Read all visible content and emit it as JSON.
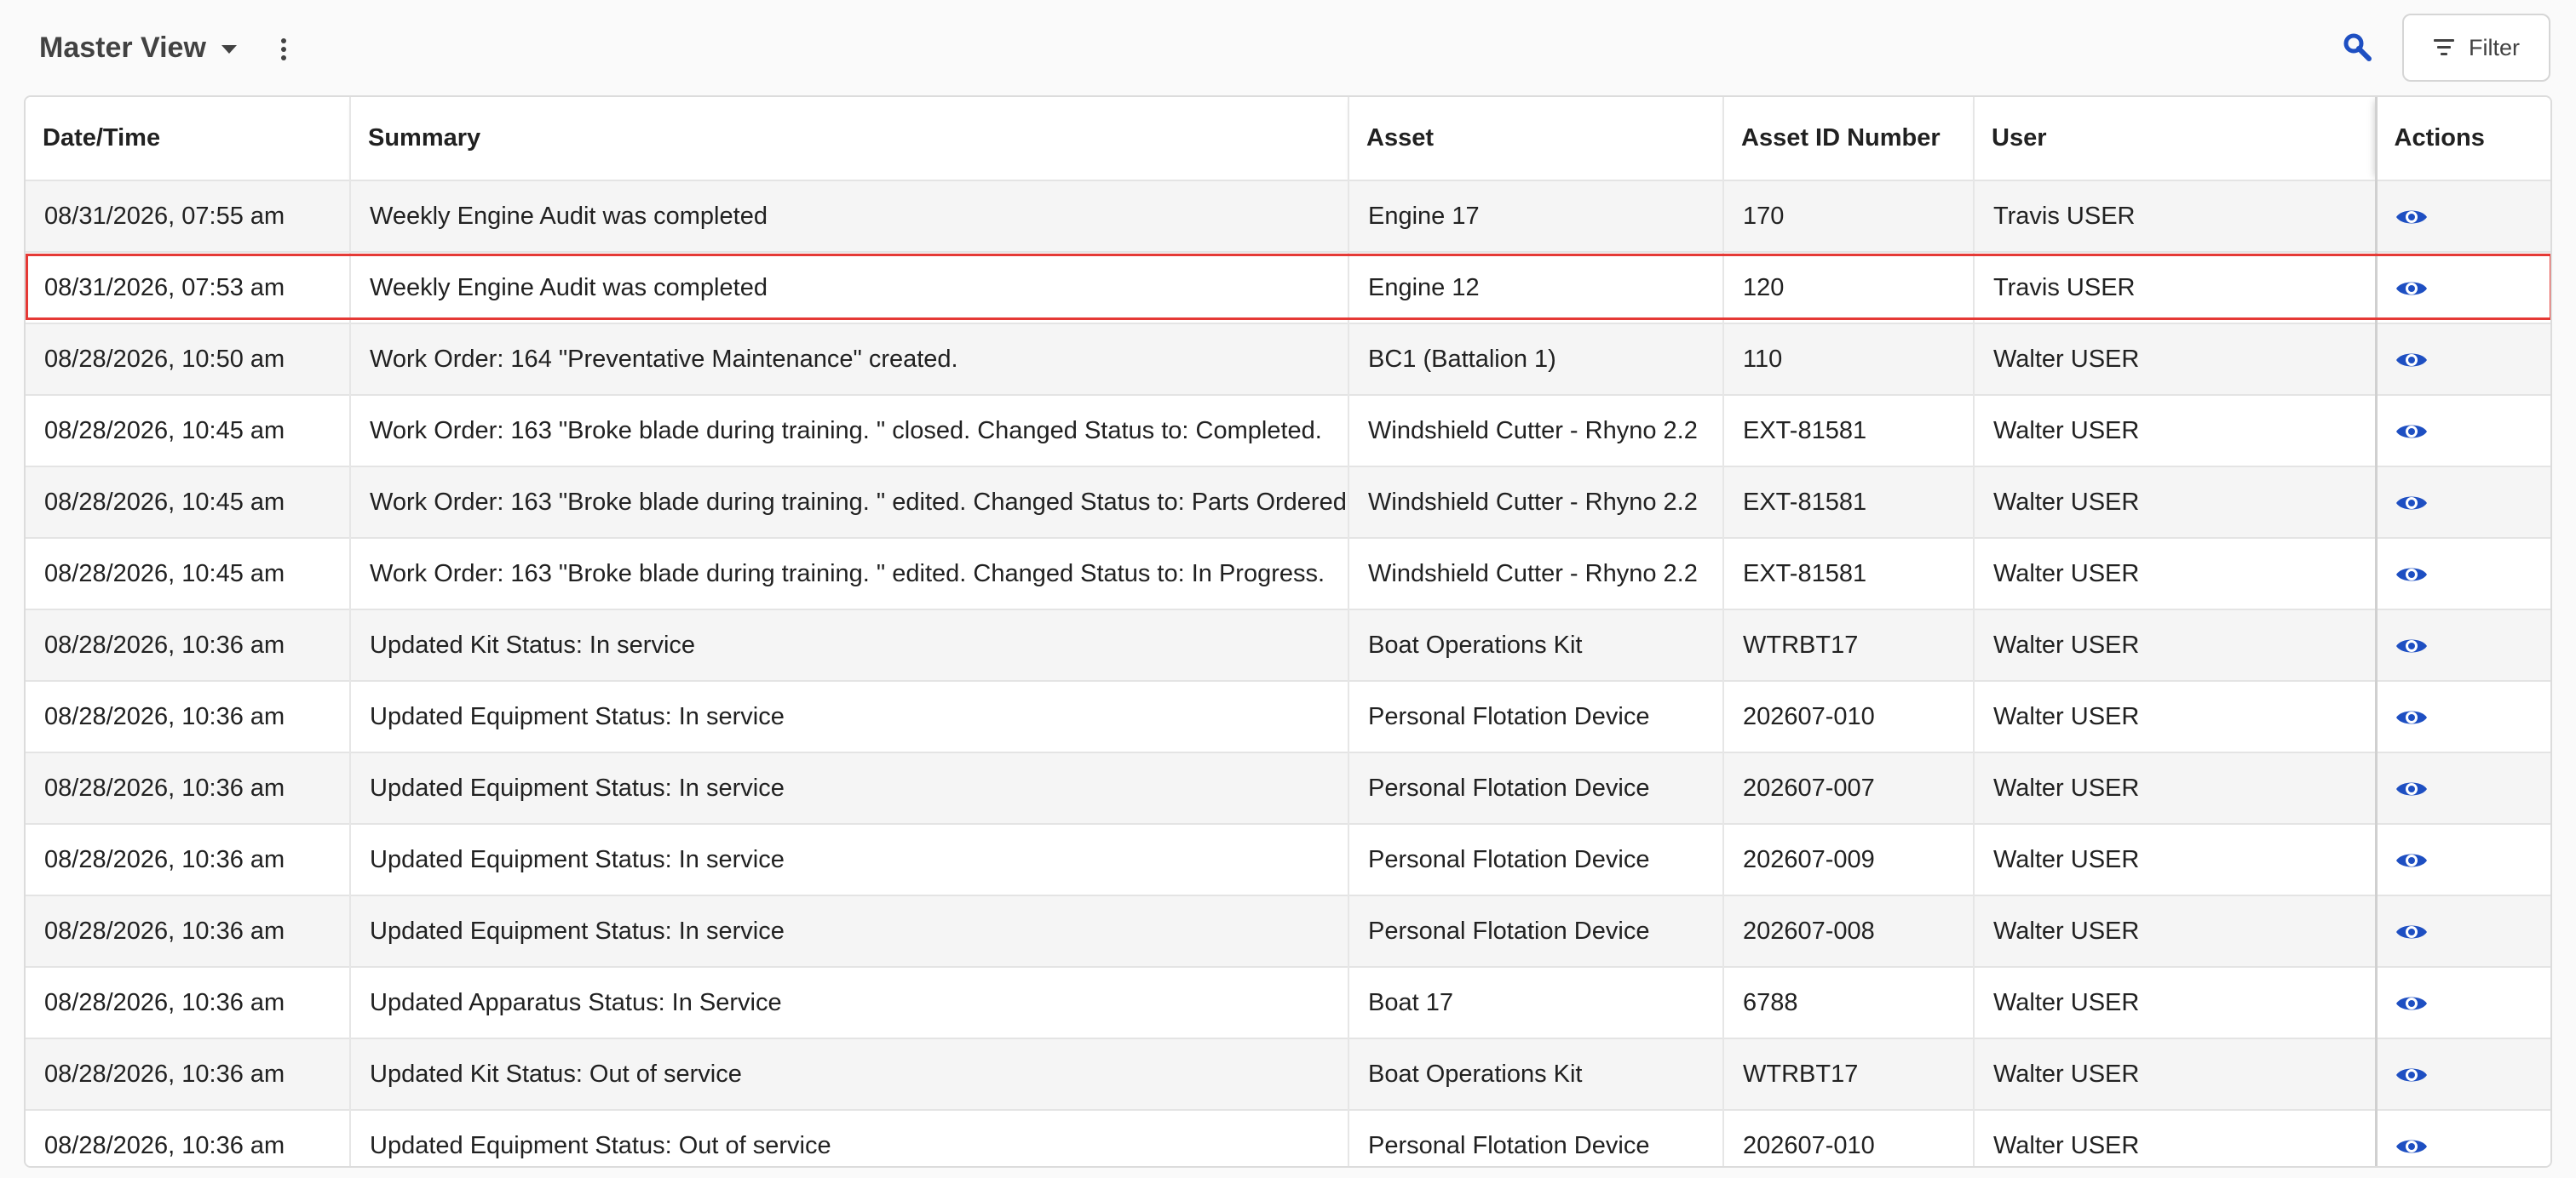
{
  "header": {
    "view_title": "Master View",
    "filter_label": "Filter"
  },
  "colors": {
    "accent": "#1e4fc2",
    "highlight": "#e53935"
  },
  "icons": {
    "caret": "chevron-down-icon",
    "menu": "more-vert-icon",
    "search": "search-icon",
    "filter": "filter-icon",
    "view": "eye-icon"
  },
  "table": {
    "columns": [
      "Date/Time",
      "Summary",
      "Asset",
      "Asset ID Number",
      "User",
      "Actions"
    ],
    "highlighted_row": 1,
    "rows": [
      {
        "datetime": "08/31/2026, 07:55 am",
        "summary": "Weekly Engine Audit was completed",
        "asset": "Engine 17",
        "asset_id": "170",
        "user": "Travis USER"
      },
      {
        "datetime": "08/31/2026, 07:53 am",
        "summary": "Weekly Engine Audit was completed",
        "asset": "Engine 12",
        "asset_id": "120",
        "user": "Travis USER"
      },
      {
        "datetime": "08/28/2026, 10:50 am",
        "summary": "Work Order: 164 \"Preventative Maintenance\" created.",
        "asset": "BC1 (Battalion 1)",
        "asset_id": "110",
        "user": "Walter USER"
      },
      {
        "datetime": "08/28/2026, 10:45 am",
        "summary": "Work Order: 163 \"Broke blade during training. \" closed. Changed Status to: Completed.",
        "asset": "Windshield Cutter - Rhyno 2.2",
        "asset_id": "EXT-81581",
        "user": "Walter USER"
      },
      {
        "datetime": "08/28/2026, 10:45 am",
        "summary": "Work Order: 163 \"Broke blade during training. \" edited. Changed Status to: Parts Ordered",
        "asset": "Windshield Cutter - Rhyno 2.2",
        "asset_id": "EXT-81581",
        "user": "Walter USER"
      },
      {
        "datetime": "08/28/2026, 10:45 am",
        "summary": "Work Order: 163 \"Broke blade during training. \" edited. Changed Status to: In Progress.",
        "asset": "Windshield Cutter - Rhyno 2.2",
        "asset_id": "EXT-81581",
        "user": "Walter USER"
      },
      {
        "datetime": "08/28/2026, 10:36 am",
        "summary": "Updated Kit Status: In service",
        "asset": "Boat Operations Kit",
        "asset_id": "WTRBT17",
        "user": "Walter USER"
      },
      {
        "datetime": "08/28/2026, 10:36 am",
        "summary": "Updated Equipment Status: In service",
        "asset": "Personal Flotation Device",
        "asset_id": "202607-010",
        "user": "Walter USER"
      },
      {
        "datetime": "08/28/2026, 10:36 am",
        "summary": "Updated Equipment Status: In service",
        "asset": "Personal Flotation Device",
        "asset_id": "202607-007",
        "user": "Walter USER"
      },
      {
        "datetime": "08/28/2026, 10:36 am",
        "summary": "Updated Equipment Status: In service",
        "asset": "Personal Flotation Device",
        "asset_id": "202607-009",
        "user": "Walter USER"
      },
      {
        "datetime": "08/28/2026, 10:36 am",
        "summary": "Updated Equipment Status: In service",
        "asset": "Personal Flotation Device",
        "asset_id": "202607-008",
        "user": "Walter USER"
      },
      {
        "datetime": "08/28/2026, 10:36 am",
        "summary": "Updated Apparatus Status: In Service",
        "asset": "Boat 17",
        "asset_id": "6788",
        "user": "Walter USER"
      },
      {
        "datetime": "08/28/2026, 10:36 am",
        "summary": "Updated Kit Status: Out of service",
        "asset": "Boat Operations Kit",
        "asset_id": "WTRBT17",
        "user": "Walter USER"
      },
      {
        "datetime": "08/28/2026, 10:36 am",
        "summary": "Updated Equipment Status: Out of service",
        "asset": "Personal Flotation Device",
        "asset_id": "202607-010",
        "user": "Walter USER"
      }
    ]
  }
}
